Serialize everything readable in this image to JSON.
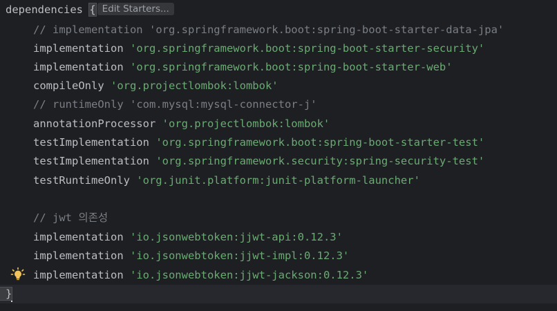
{
  "editor": {
    "header": {
      "keyword": "dependencies",
      "brace_open": "{",
      "inlay_hint": "Edit Starters..."
    },
    "lines": [
      {
        "prefix": "// implementation ",
        "string": "'org.springframework.boot:spring-boot-starter-data-jpa'",
        "kind": "comment"
      },
      {
        "prefix": "implementation ",
        "string": "'org.springframework.boot:spring-boot-starter-security'",
        "kind": "code"
      },
      {
        "prefix": "implementation ",
        "string": "'org.springframework.boot:spring-boot-starter-web'",
        "kind": "code"
      },
      {
        "prefix": "compileOnly ",
        "string": "'org.projectlombok:lombok'",
        "kind": "code"
      },
      {
        "prefix": "// runtimeOnly ",
        "string": "'com.mysql:mysql-connector-j'",
        "kind": "comment"
      },
      {
        "prefix": "annotationProcessor ",
        "string": "'org.projectlombok:lombok'",
        "kind": "code"
      },
      {
        "prefix": "testImplementation ",
        "string": "'org.springframework.boot:spring-boot-starter-test'",
        "kind": "code"
      },
      {
        "prefix": "testImplementation ",
        "string": "'org.springframework.security:spring-security-test'",
        "kind": "code"
      },
      {
        "prefix": "testRuntimeOnly ",
        "string": "'org.junit.platform:junit-platform-launcher'",
        "kind": "code"
      },
      {
        "prefix": "",
        "string": "",
        "kind": "blank"
      },
      {
        "prefix": "// jwt 의존성",
        "string": "",
        "kind": "comment"
      },
      {
        "prefix": "implementation ",
        "string": "'io.jsonwebtoken:jjwt-api:0.12.3'",
        "kind": "code"
      },
      {
        "prefix": "implementation ",
        "string": "'io.jsonwebtoken:jjwt-impl:0.12.3'",
        "kind": "code"
      },
      {
        "prefix": "implementation ",
        "string": "'io.jsonwebtoken:jjwt-jackson:0.12.3'",
        "kind": "code"
      }
    ],
    "closing_brace": "}",
    "intention_icon": "lightbulb-icon",
    "colors": {
      "background": "#1e1f22",
      "current_line": "#26282e",
      "text": "#bcbec4",
      "string": "#6aab73",
      "comment": "#7a7e85",
      "bulb": "#f2c55c"
    }
  }
}
